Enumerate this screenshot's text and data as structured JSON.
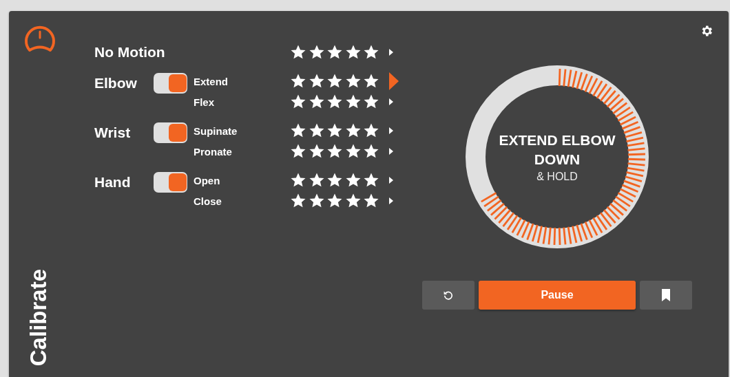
{
  "title": "Calibrate",
  "no_motion": {
    "label": "No Motion",
    "stars": 5,
    "selected": false
  },
  "groups": [
    {
      "label": "Elbow",
      "on": true,
      "motions": [
        {
          "label": "Extend",
          "stars": 5,
          "selected": true
        },
        {
          "label": "Flex",
          "stars": 5,
          "selected": false
        }
      ]
    },
    {
      "label": "Wrist",
      "on": true,
      "motions": [
        {
          "label": "Supinate",
          "stars": 5,
          "selected": false
        },
        {
          "label": "Pronate",
          "stars": 5,
          "selected": false
        }
      ]
    },
    {
      "label": "Hand",
      "on": true,
      "motions": [
        {
          "label": "Open",
          "stars": 5,
          "selected": false
        },
        {
          "label": "Close",
          "stars": 5,
          "selected": false
        }
      ]
    }
  ],
  "prompt": {
    "title": "EXTEND ELBOW DOWN",
    "subtitle": "& HOLD"
  },
  "buttons": [
    {
      "kind": "reset"
    },
    {
      "kind": "pause",
      "label": "Pause"
    },
    {
      "kind": "bookmark"
    }
  ]
}
